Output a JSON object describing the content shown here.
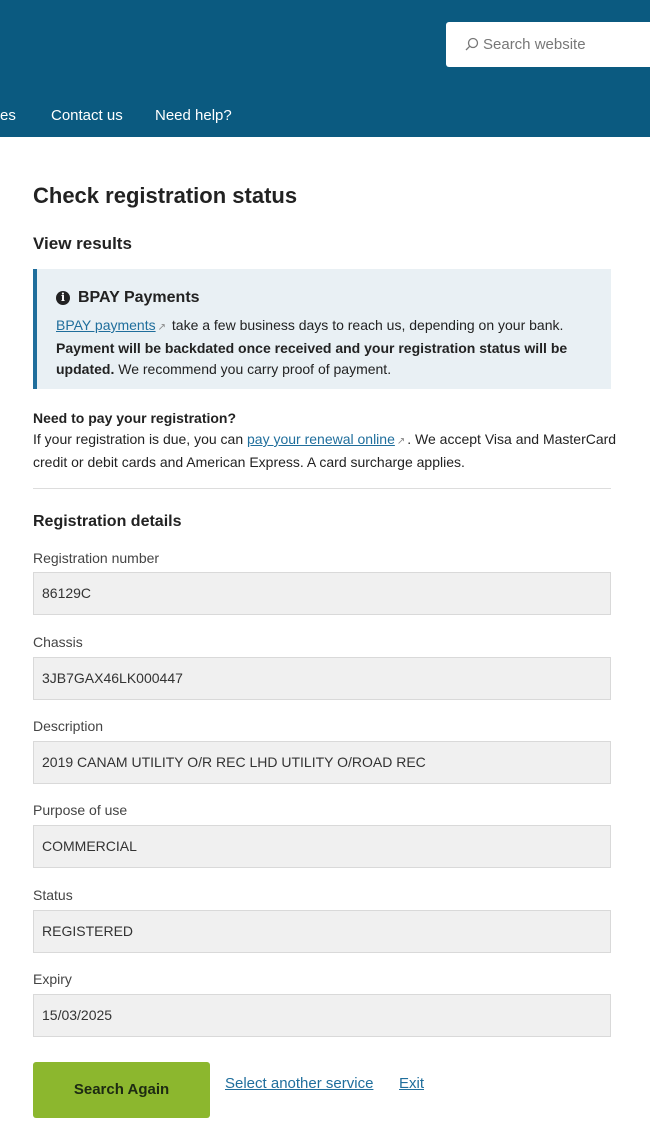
{
  "header": {
    "search_placeholder": "Search website",
    "nav": {
      "partial": "es",
      "contact": "Contact us",
      "help": "Need help?"
    }
  },
  "page_title": "Check registration status",
  "section_title": "View results",
  "notice": {
    "title": "BPAY Payments",
    "link_text": "BPAY payments",
    "text1": "take a few business days to reach us, depending on your bank.",
    "bold": "Payment will be backdated once received and your registration status will be updated.",
    "text2": "We recommend you carry proof of payment."
  },
  "pay": {
    "question": "Need to pay your registration?",
    "text1": "If your registration is due, you can",
    "link": "pay your renewal online",
    "text2": ". We accept Visa and MasterCard credit or debit cards and American Express. A card surcharge applies."
  },
  "details": {
    "title": "Registration details",
    "fields": [
      {
        "label": "Registration number",
        "value": "86129C"
      },
      {
        "label": "Chassis",
        "value": "3JB7GAX46LK000447"
      },
      {
        "label": "Description",
        "value": "2019 CANAM UTILITY O/R REC LHD UTILITY O/ROAD REC"
      },
      {
        "label": "Purpose of use",
        "value": "COMMERCIAL"
      },
      {
        "label": "Status",
        "value": "REGISTERED"
      },
      {
        "label": "Expiry",
        "value": "15/03/2025"
      }
    ]
  },
  "actions": {
    "search_again": "Search Again",
    "select_service": "Select another service",
    "exit": "Exit"
  },
  "colors": {
    "header_bg": "#0b5a80",
    "button_green": "#8cb72e",
    "link": "#1f6e9c"
  }
}
